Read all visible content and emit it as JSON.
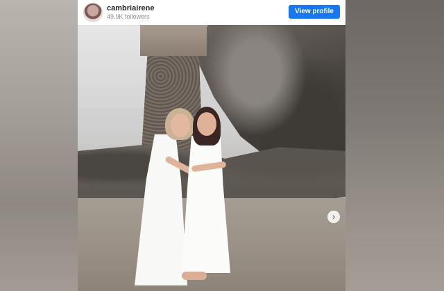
{
  "post": {
    "username": "cambriairene",
    "followers": "49.9K followers",
    "view_profile_label": "View profile",
    "next_arrow_glyph": "›"
  },
  "colors": {
    "button": "#1877f2",
    "username": "#262626",
    "followers": "#8e8e8e"
  }
}
